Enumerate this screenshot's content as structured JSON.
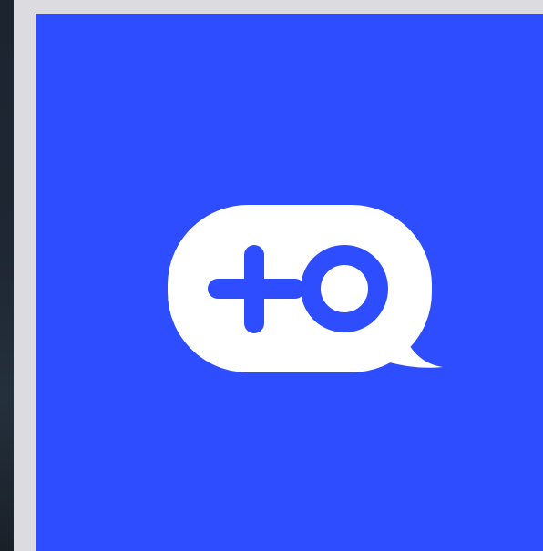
{
  "app": {
    "logo_icon": "chat-bubble-plus-o-icon"
  },
  "colors": {
    "splash_background": "#2e4dff",
    "logo_fill": "#ffffff",
    "logo_glyph": "#2e4dff",
    "chrome_background": "#dcdce0",
    "side_strip": "#1e2733"
  }
}
